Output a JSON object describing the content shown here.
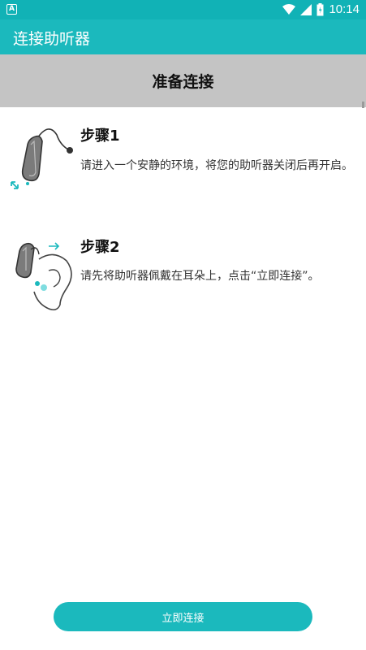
{
  "status_bar": {
    "time": "10:14",
    "notification_glyph": "A",
    "icons": [
      "wifi-icon",
      "signal-icon",
      "battery-icon"
    ]
  },
  "app_bar": {
    "title": "连接助听器"
  },
  "header": {
    "title": "准备连接"
  },
  "steps": [
    {
      "title": "步骤1",
      "description": "请进入一个安静的环境，将您的助听器关闭后再开启。",
      "icon": "hearing-aid-power-icon"
    },
    {
      "title": "步骤2",
      "description": "请先将助听器佩戴在耳朵上，点击“立即连接”。",
      "icon": "hearing-aid-ear-icon"
    }
  ],
  "connect_button": {
    "label": "立即连接"
  },
  "colors": {
    "status_bar": "#11b2b6",
    "app_bar": "#1bb9bd",
    "header_bg": "#c4c4c4",
    "accent": "#1bb9bd"
  }
}
